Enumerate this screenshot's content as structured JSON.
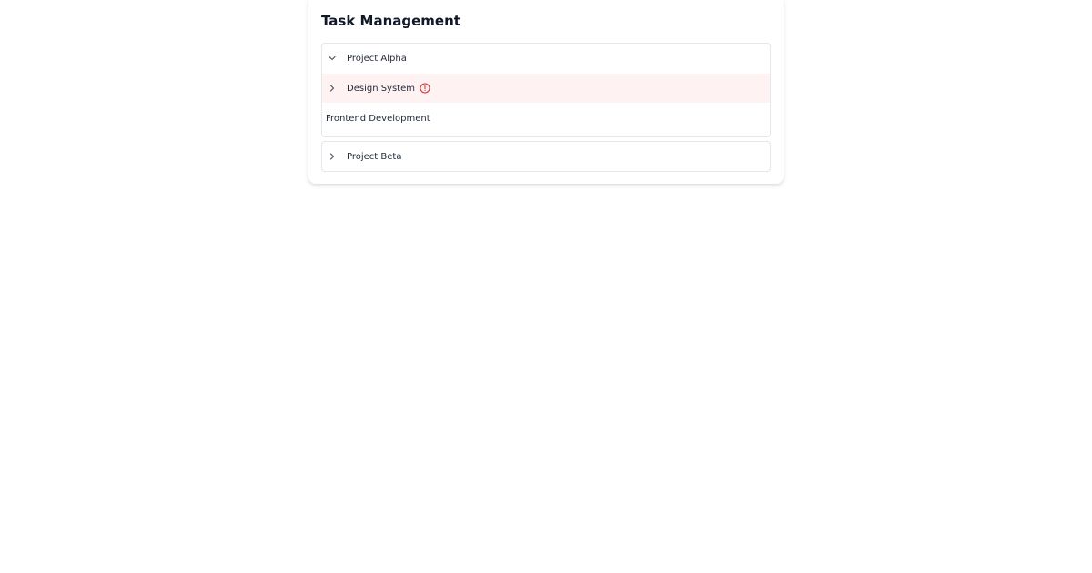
{
  "panel": {
    "title": "Task Management"
  },
  "groups": [
    {
      "label": "Project Alpha",
      "expanded": true,
      "icon": "chevron-down-icon",
      "items": [
        {
          "label": "Design System",
          "icon": "chevron-right-icon",
          "status_icon": "alert-circle-icon",
          "highlighted": true
        },
        {
          "label": "Frontend Development"
        }
      ]
    },
    {
      "label": "Project Beta",
      "expanded": false,
      "icon": "chevron-right-icon"
    }
  ],
  "colors": {
    "highlight_background": "#fef2f2",
    "alert": "#dc2626",
    "border": "#e5e7eb",
    "text": "#1f2937"
  }
}
